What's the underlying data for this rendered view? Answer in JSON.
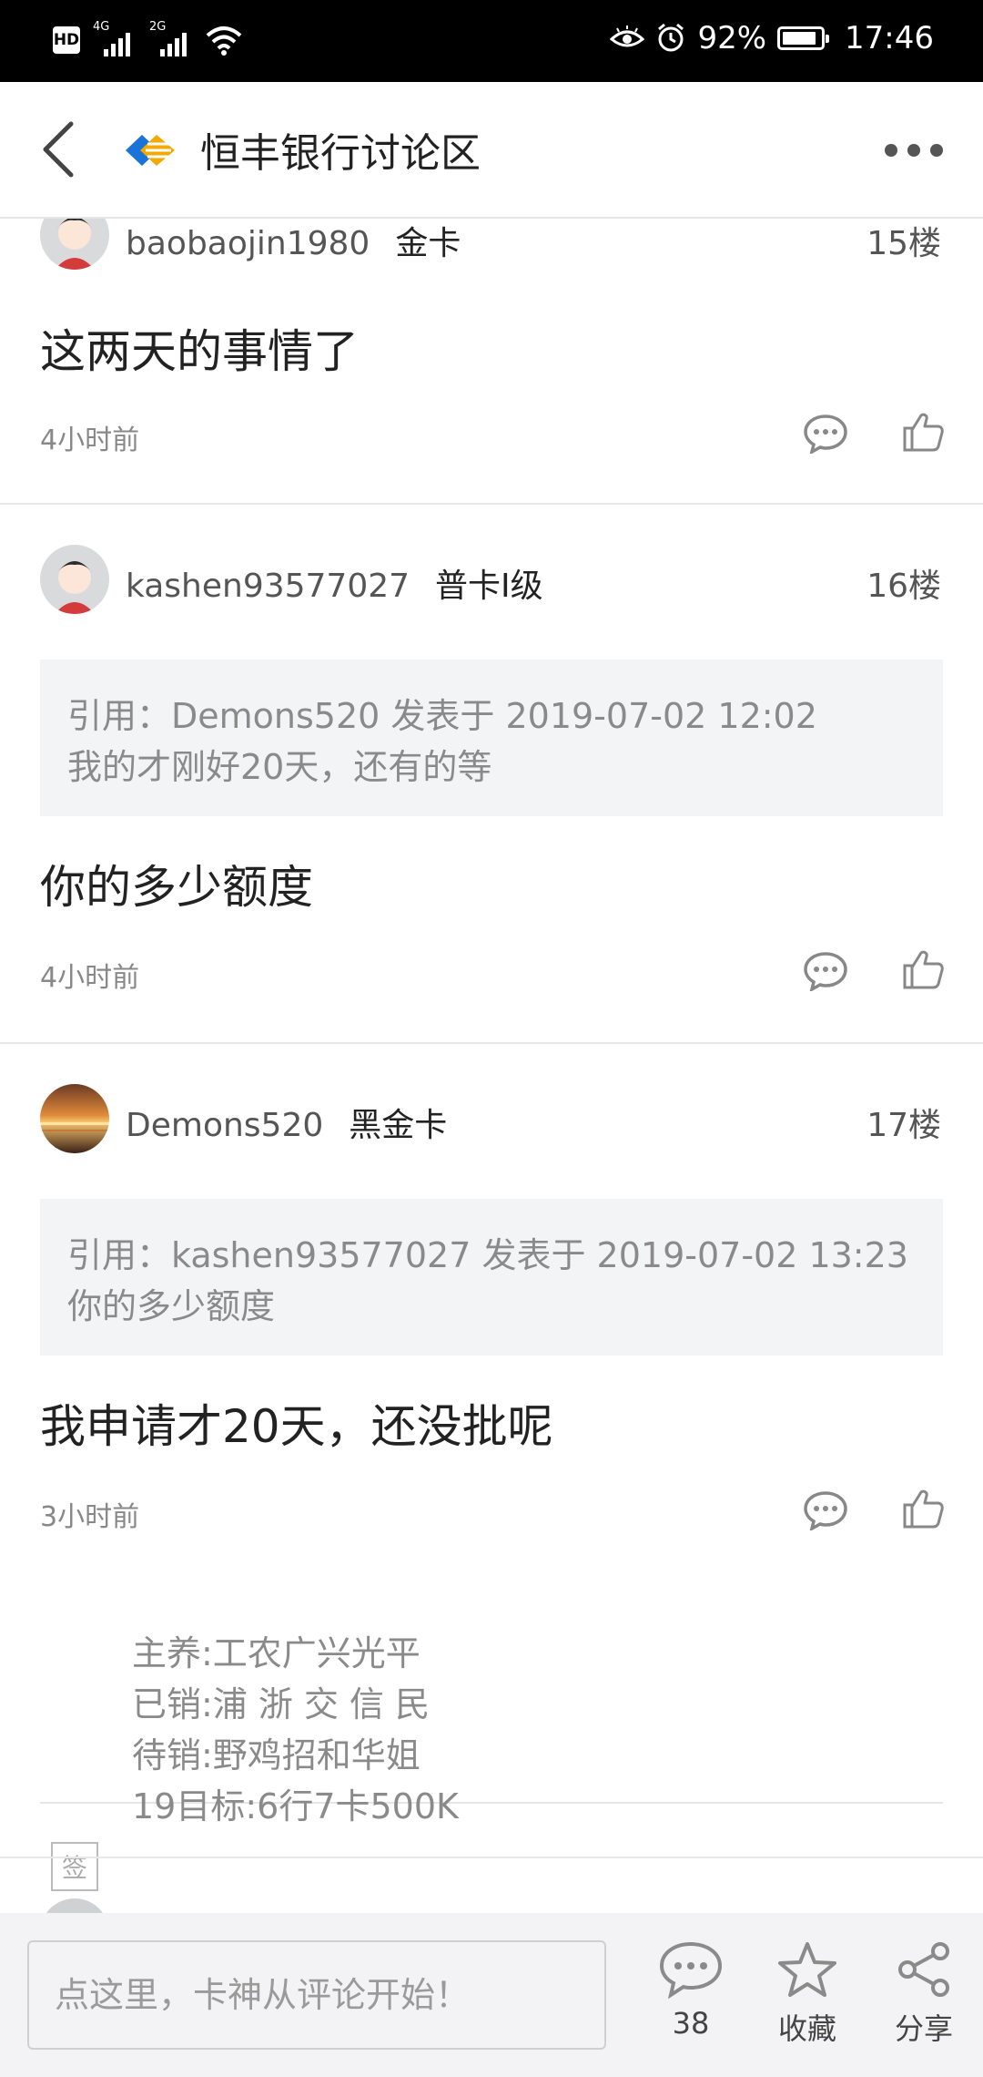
{
  "status_bar": {
    "hd": "HD",
    "net1": "4G",
    "net2": "2G",
    "battery_percent": "92%",
    "time": "17:46",
    "icons": [
      "wifi-icon",
      "eye-comfort-icon",
      "alarm-icon",
      "battery-icon"
    ]
  },
  "header": {
    "title": "恒丰银行讨论区",
    "logo_colors": [
      "#1a73d8",
      "#f2a900"
    ]
  },
  "posts": [
    {
      "username": "baobaojin1980",
      "badge": "金卡",
      "floor": "15楼",
      "content": "这两天的事情了",
      "time": "4小时前"
    },
    {
      "username": "kashen93577027",
      "badge": "普卡Ⅰ级",
      "floor": "16楼",
      "quote_line1": "引用：Demons520 发表于 2019-07-02 12:02",
      "quote_line2": "我的才刚好20天，还有的等",
      "content": "你的多少额度",
      "time": "4小时前"
    },
    {
      "username": "Demons520",
      "badge": "黑金卡",
      "floor": "17楼",
      "quote_line1": "引用：kashen93577027 发表于 2019-07-02 13:23",
      "quote_line2": "你的多少额度",
      "content": "我申请才20天，还没批呢",
      "time": "3小时前",
      "signature_icon": "签",
      "signature": [
        "主养:工农广兴光平",
        "已销:浦 浙 交 信  民",
        "待销:野鸡招和华姐",
        "19目标:6行7卡500K"
      ]
    }
  ],
  "bottom_bar": {
    "input_placeholder": "点这里，卡神从评论开始！",
    "comment_count": "38",
    "favorite_label": "收藏",
    "share_label": "分享"
  }
}
